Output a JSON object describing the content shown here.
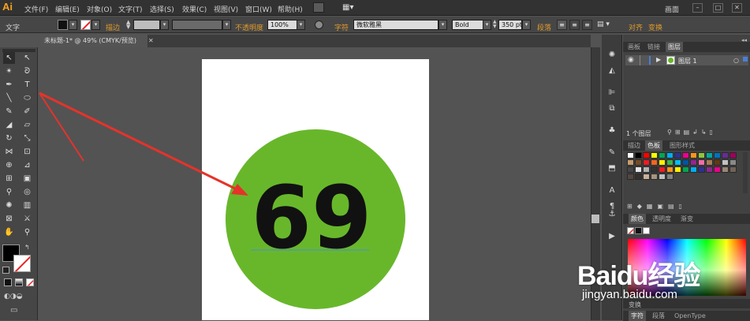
{
  "app": {
    "logo": "Ai"
  },
  "menu": {
    "items": [
      "文件(F)",
      "编辑(E)",
      "对象(O)",
      "文字(T)",
      "选择(S)",
      "效果(C)",
      "视图(V)",
      "窗口(W)",
      "帮助(H)"
    ],
    "workspace": "画面"
  },
  "options_bar": {
    "selection_label": "文字",
    "stroke_label": "描边",
    "opacity_label": "不透明度",
    "opacity_value": "100%",
    "char_label": "字符",
    "font_family": "微软雅黑",
    "font_style": "Bold",
    "font_size": "350 pt",
    "paragraph_label": "段落",
    "align_label": "对齐",
    "transform_label": "变换"
  },
  "document": {
    "tab_title": "未标题-1* @ 49% (CMYK/预览)"
  },
  "artwork": {
    "number_text": "69",
    "circle_color": "#68b72b",
    "text_color": "#111111",
    "arrow_color": "#e5332a"
  },
  "layers_panel": {
    "tabs": [
      "画板",
      "链接",
      "图层"
    ],
    "layer_name": "图层 1",
    "count_label": "1 个图层"
  },
  "swatch_panel": {
    "tabs": [
      "描边",
      "色板",
      "图形样式"
    ]
  },
  "color_panel": {
    "tabs": [
      "颜色",
      "透明度",
      "渐变"
    ]
  },
  "bottom_panels": {
    "transform_tab": "变换",
    "tabs": [
      "字符",
      "段落",
      "OpenType"
    ]
  },
  "watermark": {
    "brand": "Baidu经验",
    "url": "jingyan.baidu.com"
  }
}
